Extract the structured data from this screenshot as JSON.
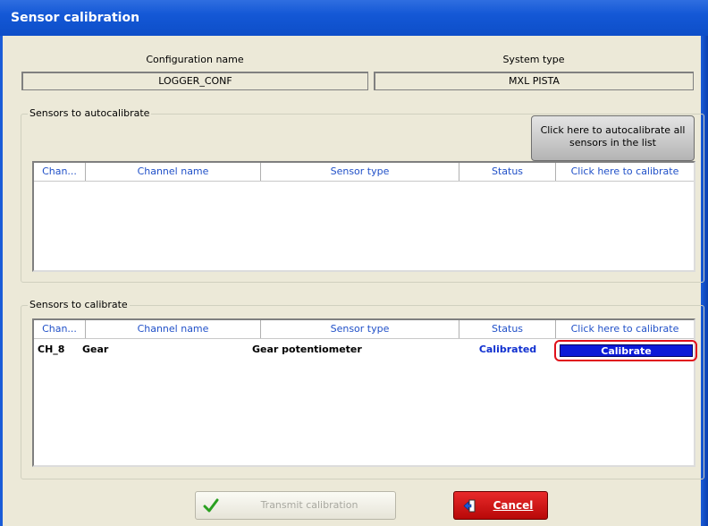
{
  "window": {
    "title": "Sensor calibration"
  },
  "config": {
    "name_label": "Configuration name",
    "name_value": "LOGGER_CONF",
    "system_label": "System type",
    "system_value": "MXL PISTA"
  },
  "autocalibrate": {
    "legend": "Sensors to autocalibrate",
    "button_line1": "Click here to autocalibrate all",
    "button_line2": "sensors  in the list",
    "columns": [
      "Chan...",
      "Channel name",
      "Sensor type",
      "Status",
      "Click here to calibrate"
    ],
    "rows": []
  },
  "calibrate": {
    "legend": "Sensors to calibrate",
    "columns": [
      "Chan...",
      "Channel name",
      "Sensor type",
      "Status",
      "Click here to calibrate"
    ],
    "rows": [
      {
        "channel": "CH_8",
        "name": "Gear",
        "sensor_type": "Gear potentiometer",
        "status": "Calibrated",
        "action": "Calibrate"
      }
    ]
  },
  "footer": {
    "transmit_label": "Transmit calibration",
    "cancel_label": "Cancel"
  },
  "colors": {
    "title_bar": "#1458d6",
    "status_blue": "#1030d0",
    "calibrate_button": "#0c1ad8",
    "highlight_red": "#e0101a",
    "cancel_red": "#d01414"
  },
  "icons": {
    "transmit": "checkmark-icon",
    "cancel": "exit-door-icon"
  }
}
